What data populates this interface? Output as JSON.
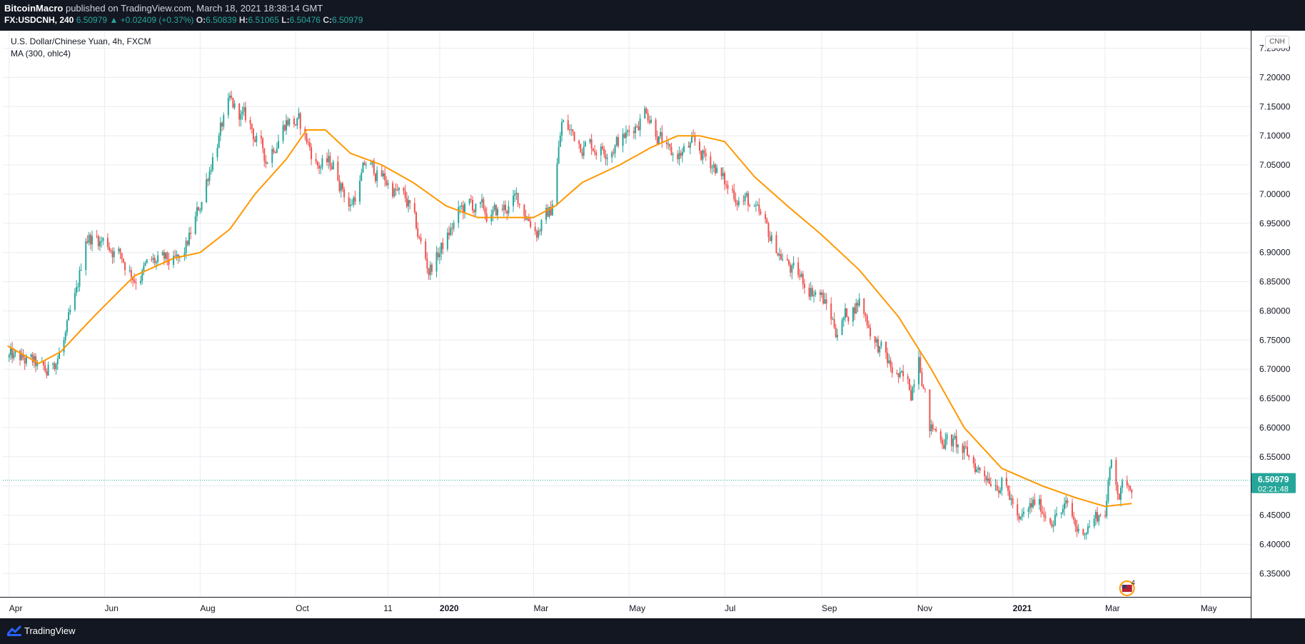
{
  "header": {
    "author": "BitcoinMacro",
    "published": "published on TradingView.com, March 18, 2021 18:38:14 GMT",
    "symbol": "FX:USDCNH, 240",
    "last": "6.50979",
    "arrow": "▲",
    "change": "+0.02409 (+0.37%)",
    "open_label": "O:",
    "open": "6.50839",
    "high_label": "H:",
    "high": "6.51065",
    "low_label": "L:",
    "low": "6.50476",
    "close_label": "C:",
    "close": "6.50979"
  },
  "legend": {
    "title": "U.S. Dollar/Chinese Yuan, 4h, FXCM",
    "indicator": "MA (300, ohlc4)"
  },
  "currency_badge": "CNH",
  "price_label": {
    "value": "6.50979",
    "countdown": "02:21:48"
  },
  "event_badge": "4",
  "footer": {
    "brand": "TradingView"
  },
  "colors": {
    "up": "#26a69a",
    "down": "#ef5350",
    "ma": "#ff9800",
    "grid": "#e9ecf1",
    "background": "#ffffff",
    "frame": "#131722"
  },
  "icons": [
    "tradingview-logo-icon",
    "us-flag-event-icon"
  ],
  "chart_data": {
    "type": "line",
    "ylim": [
      6.31,
      7.28
    ],
    "yticks": [
      6.35,
      6.4,
      6.45,
      6.5,
      6.55,
      6.6,
      6.65,
      6.7,
      6.75,
      6.8,
      6.85,
      6.9,
      6.95,
      7.0,
      7.05,
      7.1,
      7.15,
      7.2,
      7.25
    ],
    "yticklabels": [
      "6.35000",
      "6.40000",
      "6.45000",
      "6.50000",
      "6.55000",
      "6.60000",
      "6.65000",
      "6.70000",
      "6.75000",
      "6.80000",
      "6.85000",
      "6.90000",
      "6.95000",
      "7.00000",
      "7.05000",
      "7.10000",
      "7.15000",
      "7.20000",
      "7.25000"
    ],
    "xlim": [
      "2019-03-28",
      "2021-06-02"
    ],
    "xticks": [
      {
        "date": "2019-04-01",
        "label": "Apr",
        "bold": false
      },
      {
        "date": "2019-06-01",
        "label": "Jun",
        "bold": false
      },
      {
        "date": "2019-08-01",
        "label": "Aug",
        "bold": false
      },
      {
        "date": "2019-10-01",
        "label": "Oct",
        "bold": false
      },
      {
        "date": "2019-11-29",
        "label": "11",
        "bold": false
      },
      {
        "date": "2020-01-01",
        "label": "2020",
        "bold": true
      },
      {
        "date": "2020-03-01",
        "label": "Mar",
        "bold": false
      },
      {
        "date": "2020-05-01",
        "label": "May",
        "bold": false
      },
      {
        "date": "2020-07-01",
        "label": "Jul",
        "bold": false
      },
      {
        "date": "2020-09-01",
        "label": "Sep",
        "bold": false
      },
      {
        "date": "2020-11-01",
        "label": "Nov",
        "bold": false
      },
      {
        "date": "2021-01-01",
        "label": "2021",
        "bold": true
      },
      {
        "date": "2021-03-01",
        "label": "Mar",
        "bold": false
      },
      {
        "date": "2021-05-01",
        "label": "May",
        "bold": false
      }
    ],
    "series": [
      {
        "name": "U.S. Dollar/Chinese Yuan",
        "style": "candles",
        "x": [
          "2019-03-31",
          "2019-04-15",
          "2019-04-25",
          "2019-05-05",
          "2019-05-14",
          "2019-05-20",
          "2019-06-01",
          "2019-06-10",
          "2019-06-20",
          "2019-07-01",
          "2019-07-20",
          "2019-08-01",
          "2019-08-10",
          "2019-08-20",
          "2019-09-01",
          "2019-09-12",
          "2019-09-25",
          "2019-10-03",
          "2019-10-15",
          "2019-10-25",
          "2019-11-05",
          "2019-11-15",
          "2019-11-25",
          "2019-12-02",
          "2019-12-12",
          "2019-12-25",
          "2020-01-05",
          "2020-01-14",
          "2020-01-21",
          "2020-02-03",
          "2020-02-20",
          "2020-03-03",
          "2020-03-12",
          "2020-03-19",
          "2020-03-31",
          "2020-04-15",
          "2020-04-30",
          "2020-05-12",
          "2020-05-27",
          "2020-06-10",
          "2020-06-25",
          "2020-07-02",
          "2020-07-15",
          "2020-07-31",
          "2020-08-15",
          "2020-08-31",
          "2020-09-10",
          "2020-09-25",
          "2020-10-05",
          "2020-10-15",
          "2020-10-28",
          "2020-11-02",
          "2020-11-09",
          "2020-11-25",
          "2020-12-10",
          "2020-12-25",
          "2021-01-01",
          "2021-01-05",
          "2021-01-15",
          "2021-01-25",
          "2021-02-05",
          "2021-02-12",
          "2021-02-20",
          "2021-03-01",
          "2021-03-05",
          "2021-03-10",
          "2021-03-18"
        ],
        "y": [
          6.72,
          6.71,
          6.69,
          6.74,
          6.82,
          6.93,
          6.92,
          6.9,
          6.86,
          6.88,
          6.88,
          6.98,
          7.08,
          7.15,
          7.12,
          7.06,
          7.13,
          7.12,
          7.05,
          7.05,
          6.98,
          7.05,
          7.03,
          7.01,
          6.98,
          6.87,
          6.92,
          6.97,
          6.98,
          6.96,
          6.99,
          6.94,
          6.97,
          7.12,
          7.09,
          7.08,
          7.1,
          7.15,
          7.06,
          7.08,
          7.05,
          7.01,
          6.99,
          6.92,
          6.86,
          6.83,
          6.77,
          6.82,
          6.75,
          6.7,
          6.66,
          6.74,
          6.6,
          6.57,
          6.53,
          6.51,
          6.47,
          6.43,
          6.47,
          6.45,
          6.46,
          6.42,
          6.44,
          6.46,
          6.54,
          6.49,
          6.51
        ]
      },
      {
        "name": "MA (300, ohlc4)",
        "style": "line",
        "x": [
          "2019-03-31",
          "2019-04-20",
          "2019-05-04",
          "2019-05-25",
          "2019-06-20",
          "2019-07-15",
          "2019-08-01",
          "2019-08-20",
          "2019-09-05",
          "2019-09-25",
          "2019-10-08",
          "2019-10-20",
          "2019-11-05",
          "2019-11-25",
          "2019-12-15",
          "2020-01-05",
          "2020-01-25",
          "2020-02-15",
          "2020-03-01",
          "2020-03-15",
          "2020-04-01",
          "2020-04-25",
          "2020-05-15",
          "2020-06-01",
          "2020-06-15",
          "2020-07-01",
          "2020-07-20",
          "2020-08-10",
          "2020-09-01",
          "2020-09-25",
          "2020-10-20",
          "2020-11-10",
          "2020-12-01",
          "2020-12-25",
          "2021-01-20",
          "2021-02-10",
          "2021-03-01",
          "2021-03-18"
        ],
        "y": [
          6.74,
          6.71,
          6.73,
          6.79,
          6.86,
          6.89,
          6.9,
          6.94,
          7.0,
          7.06,
          7.11,
          7.11,
          7.07,
          7.05,
          7.02,
          6.98,
          6.96,
          6.96,
          6.96,
          6.98,
          7.02,
          7.05,
          7.08,
          7.1,
          7.1,
          7.09,
          7.03,
          6.98,
          6.93,
          6.87,
          6.79,
          6.7,
          6.6,
          6.53,
          6.5,
          6.48,
          6.465,
          6.47
        ]
      }
    ],
    "last_price": 6.50979
  }
}
